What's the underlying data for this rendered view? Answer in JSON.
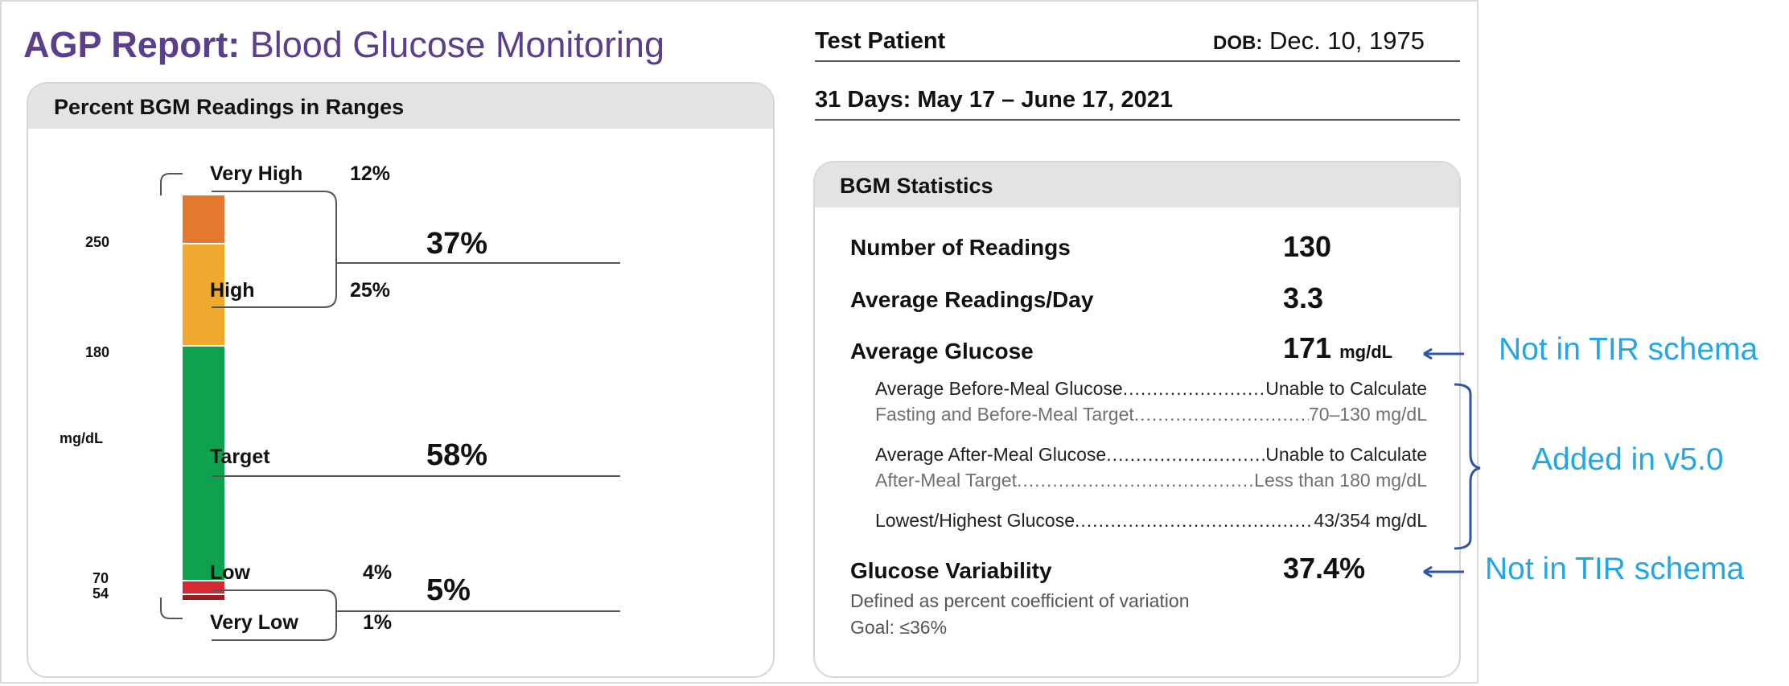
{
  "report": {
    "title_bold": "AGP Report:",
    "title_rest": "Blood Glucose Monitoring"
  },
  "ranges_panel": {
    "header": "Percent BGM Readings in Ranges",
    "axis_ticks": [
      "250",
      "180",
      "70",
      "54"
    ],
    "axis_unit": "mg/dL",
    "items": [
      {
        "label": "Very High",
        "percent": "12%"
      },
      {
        "label": "High",
        "percent": "25%"
      },
      {
        "label": "Target",
        "percent": "58%"
      },
      {
        "label": "Low",
        "percent": "4%"
      },
      {
        "label": "Very Low",
        "percent": "1%"
      }
    ],
    "group_high_total": "37%",
    "group_low_total": "5%",
    "colors": {
      "very_high": "#e5782f",
      "high": "#f0a92f",
      "target": "#0ea24f",
      "low": "#d62a33",
      "very_low": "#9b1c20"
    }
  },
  "patient": {
    "name": "Test Patient",
    "dob_label": "DOB:",
    "dob": "Dec. 10, 1975",
    "period": "31 Days: May 17 – June 17, 2021"
  },
  "stats_panel": {
    "header": "BGM Statistics",
    "rows": [
      {
        "label": "Number of Readings",
        "value": "130"
      },
      {
        "label": "Average Readings/Day",
        "value": "3.3"
      },
      {
        "label": "Average Glucose",
        "value": "171",
        "unit": "mg/dL"
      }
    ],
    "details": [
      {
        "label": "Average Before-Meal Glucose",
        "value": "Unable to Calculate"
      },
      {
        "label": "Fasting and Before-Meal Target",
        "value": "70–130 mg/dL"
      },
      {
        "label": "Average After-Meal Glucose",
        "value": "Unable to Calculate"
      },
      {
        "label": "After-Meal Target",
        "value": "Less than 180 mg/dL"
      },
      {
        "label": "Lowest/Highest Glucose",
        "value": "43/354 mg/dL"
      }
    ],
    "variability": {
      "label": "Glucose Variability",
      "value": "37.4%",
      "description": "Defined as percent coefficient of variation",
      "goal": "Goal: ≤36%"
    }
  },
  "annotations": {
    "avg_glucose_note": "Not in TIR schema",
    "added_note": "Added in v5.0",
    "variability_note": "Not in TIR schema",
    "color": "#23a6e6"
  }
}
